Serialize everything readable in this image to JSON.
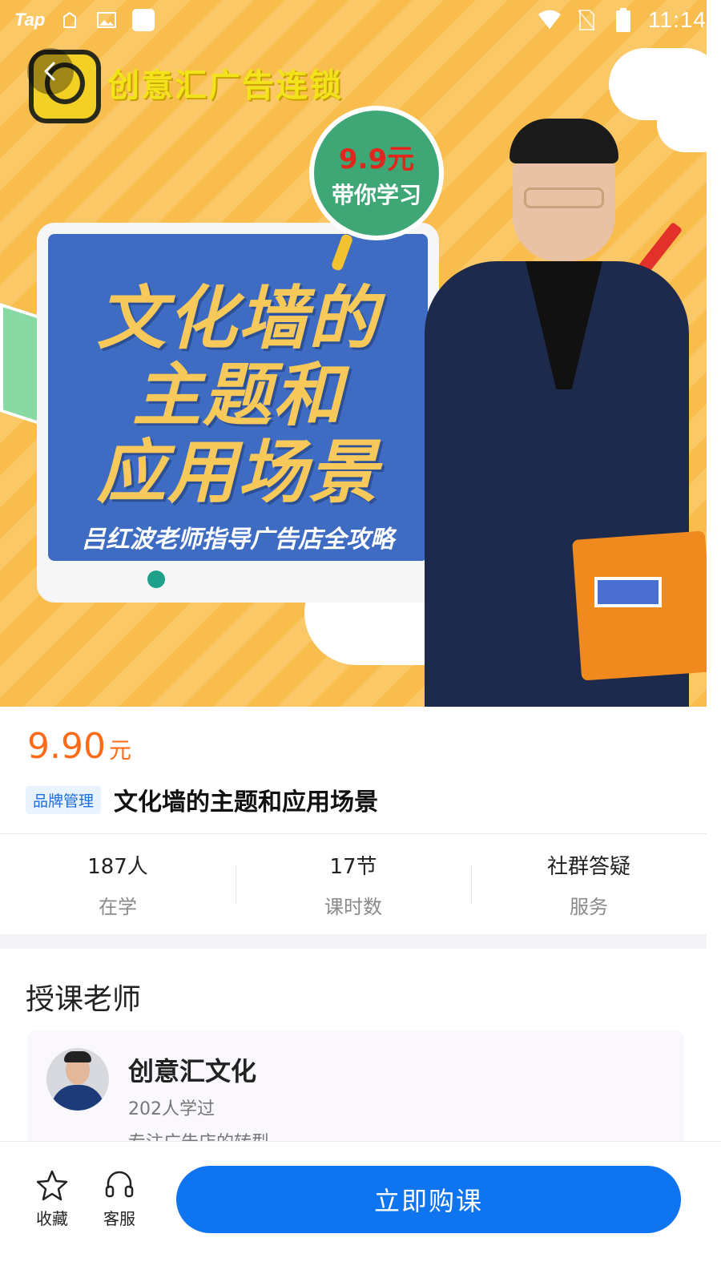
{
  "status_bar": {
    "app_label": "Tap",
    "time": "11:14",
    "icons": [
      "taptap-icon",
      "clipboard-icon",
      "image-icon",
      "square-icon",
      "wifi-icon",
      "no-sim-icon",
      "battery-icon"
    ]
  },
  "banner": {
    "brand_name": "创意汇广告连锁",
    "price_badge_top": "9.9元",
    "price_badge_bottom": "带你学习",
    "poster_title_line1": "文化墙的",
    "poster_title_line2": "主题和",
    "poster_title_line3": "应用场景",
    "poster_subtitle": "吕红波老师指导广告店全攻略",
    "colors": {
      "background": "#f9bd4d",
      "screen": "#3f6cc3",
      "badge": "#3fa776"
    }
  },
  "course": {
    "price": "9.90",
    "price_unit": "元",
    "category": "品牌管理",
    "title": "文化墙的主题和应用场景"
  },
  "stats": [
    {
      "value": "187人",
      "label": "在学"
    },
    {
      "value": "17节",
      "label": "课时数"
    },
    {
      "value": "社群答疑",
      "label": "服务"
    }
  ],
  "teacher_section": {
    "heading": "授课老师",
    "name": "创意汇文化",
    "learners": "202人学过",
    "intro": "专注广告店的转型"
  },
  "bottom_bar": {
    "favorite_label": "收藏",
    "service_label": "客服",
    "buy_label": "立即购课"
  },
  "accent_colors": {
    "primary": "#0f74f0",
    "price": "#ff6b1a",
    "tag": "#1d6fe0"
  }
}
